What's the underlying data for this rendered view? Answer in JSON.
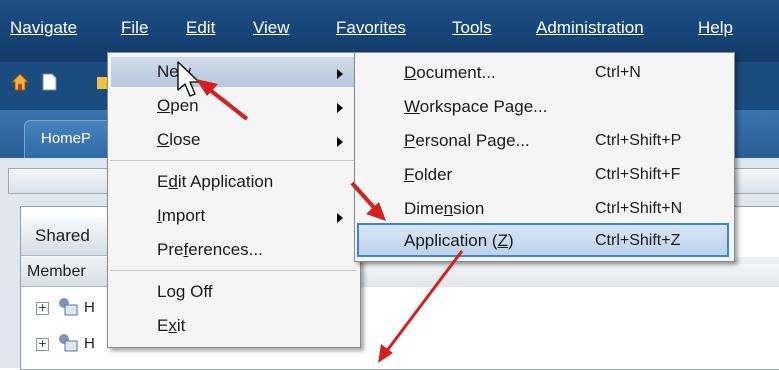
{
  "menubar": {
    "items": [
      {
        "label": "Navigate"
      },
      {
        "label": "File"
      },
      {
        "label": "Edit"
      },
      {
        "label": "View"
      },
      {
        "label": "Favorites"
      },
      {
        "label": "Tools"
      },
      {
        "label": "Administration"
      },
      {
        "label": "Help"
      }
    ]
  },
  "tabs": {
    "home": "HomeP"
  },
  "panel": {
    "shared": "Shared",
    "member": "Member",
    "rows": [
      {
        "label": "H"
      },
      {
        "label": "H"
      }
    ]
  },
  "file_menu": {
    "items": [
      {
        "pre": "Ne",
        "u": "",
        "post": "w",
        "submenu": true
      },
      {
        "pre": "",
        "u": "O",
        "post": "pen",
        "submenu": true
      },
      {
        "pre": "",
        "u": "C",
        "post": "lose",
        "submenu": true
      },
      {
        "pre": "E",
        "u": "d",
        "post": "it Application",
        "submenu": false
      },
      {
        "pre": "",
        "u": "I",
        "post": "mport",
        "submenu": true
      },
      {
        "pre": "Pre",
        "u": "f",
        "post": "erences...",
        "submenu": false
      },
      {
        "pre": "Lo",
        "u": "g",
        "post": " Off",
        "submenu": false
      },
      {
        "pre": "E",
        "u": "x",
        "post": "it",
        "submenu": false
      }
    ]
  },
  "new_submenu": {
    "items": [
      {
        "pre": "",
        "u": "D",
        "post": "ocument...",
        "shortcut": "Ctrl+N"
      },
      {
        "pre": "",
        "u": "W",
        "post": "orkspace Page...",
        "shortcut": ""
      },
      {
        "pre": "",
        "u": "P",
        "post": "ersonal Page...",
        "shortcut": "Ctrl+Shift+P"
      },
      {
        "pre": "",
        "u": "F",
        "post": "older",
        "shortcut": "Ctrl+Shift+F"
      },
      {
        "pre": "Dime",
        "u": "n",
        "post": "sion",
        "shortcut": "Ctrl+Shift+N"
      },
      {
        "pre": "Application (",
        "u": "Z",
        "post": ")",
        "shortcut": "Ctrl+Shift+Z"
      }
    ]
  },
  "colors": {
    "menubar": "#17467a",
    "highlight_border": "#3b84d6",
    "arrow": "#d42020"
  }
}
